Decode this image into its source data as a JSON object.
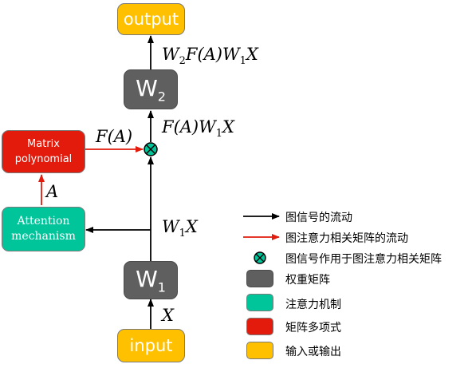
{
  "nodes": {
    "output": "output",
    "input": "input",
    "w2": "W",
    "w2_sub": "2",
    "w1": "W",
    "w1_sub": "1",
    "matrix_line1": "Matrix",
    "matrix_line2": "polynomial",
    "attention_line1": "Attention",
    "attention_line2": "mechanism"
  },
  "edge_labels": {
    "x": "X",
    "w1x_w": "W",
    "w1x_sub": "1",
    "w1x_x": "X",
    "a": "A",
    "fa": "F(A)",
    "mid_f": "F(A)W",
    "mid_sub": "1",
    "mid_x": "X",
    "top_w": "W",
    "top_sub2": "2",
    "top_f": "F(A)W",
    "top_sub1": "1",
    "top_x": "X"
  },
  "legend": [
    {
      "label": "图信号的流动",
      "kind": "arrow-black"
    },
    {
      "label": "图注意力相关矩阵的流动",
      "kind": "arrow-red"
    },
    {
      "label": "图信号作用于图注意力相关矩阵",
      "kind": "otimes"
    },
    {
      "label": "权重矩阵",
      "kind": "swatch",
      "color": "#5f5f5f"
    },
    {
      "label": "注意力机制",
      "kind": "swatch",
      "color": "#00c49a"
    },
    {
      "label": "矩阵多项式",
      "kind": "swatch",
      "color": "#e31b0c"
    },
    {
      "label": "输入或输出",
      "kind": "swatch",
      "color": "#ffc000"
    }
  ],
  "colors": {
    "signal_arrow": "#000000",
    "attention_arrow": "#e31b0c",
    "otimes_fill": "#00c49a"
  }
}
